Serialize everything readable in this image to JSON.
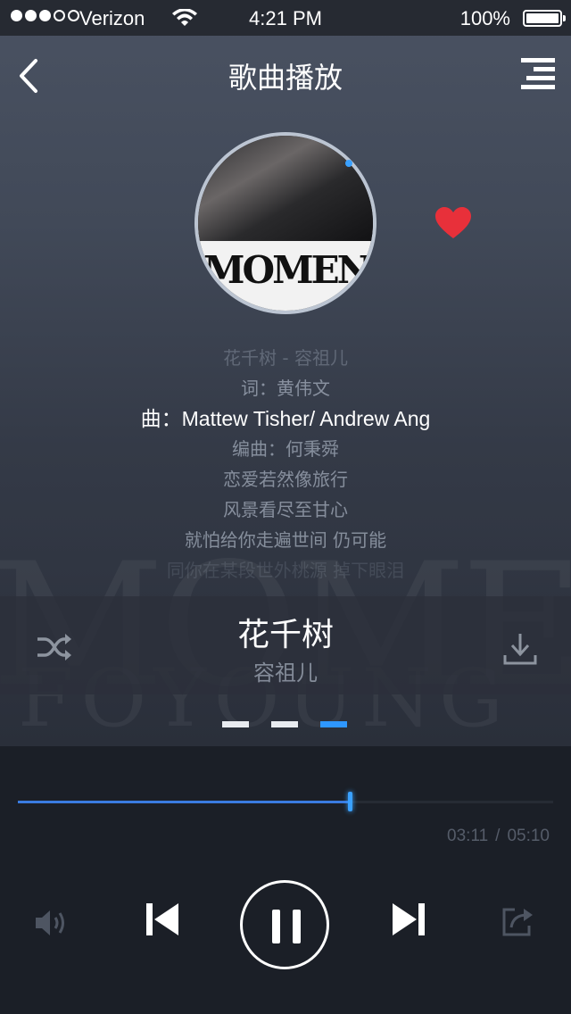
{
  "status_bar": {
    "carrier": "Verizon",
    "time": "4:21 PM",
    "battery": "100%",
    "signal_bars": 3
  },
  "nav": {
    "title": "歌曲播放",
    "back_icon": "chevron-left-icon",
    "menu_icon": "playlist-menu-icon"
  },
  "album": {
    "cover_text": "MOMENT",
    "favorite": true
  },
  "lyrics": [
    "花千树 - 容祖儿",
    "词：黄伟文",
    "曲：Mattew Tisher/ Andrew Ang",
    "编曲：何秉舜",
    "恋爱若然像旅行",
    "风景看尽至甘心",
    "就怕给你走遍世间 仍可能",
    "同你在某段世外桃源 掉下眼泪"
  ],
  "song": {
    "title": "花千树",
    "artist": "容祖儿"
  },
  "pager": {
    "count": 3,
    "active": 2
  },
  "player": {
    "current_time": "03:11",
    "separator": "/",
    "total_time": "05:10",
    "progress": 0.62,
    "state": "playing"
  },
  "colors": {
    "accent": "#3aa1ff",
    "favorite": "#e8303a",
    "background": "#1b1f27"
  }
}
